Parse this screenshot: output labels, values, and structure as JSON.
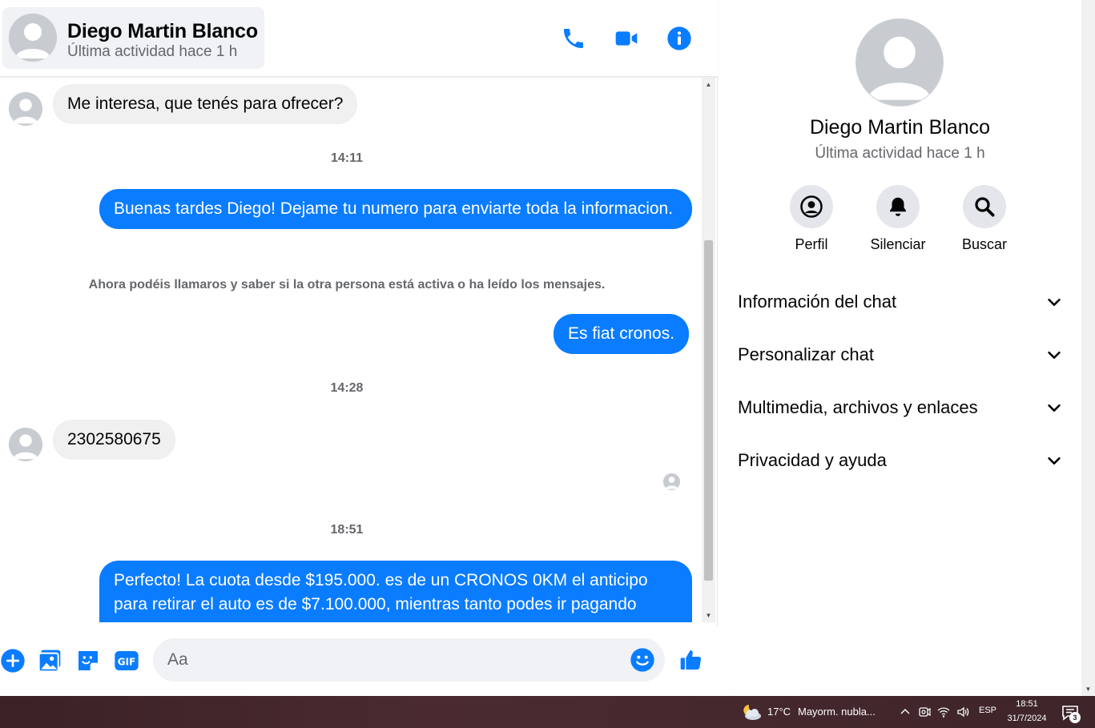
{
  "contact": {
    "name": "Diego Martin Blanco",
    "status": "Última actividad hace 1 h"
  },
  "messages": {
    "m1": "Me interesa, que tenés para ofrecer?",
    "t1": "14:11",
    "m2": "Buenas tardes Diego! Dejame tu numero para enviarte toda la informacion.",
    "note": "Ahora podéis llamaros y saber si la otra persona está activa o ha leído los mensajes.",
    "m3": "Es fiat cronos.",
    "t2": "14:28",
    "m4": "2302580675",
    "t3": "18:51",
    "m5": "Perfecto! La cuota desde $195.000. es de un CRONOS 0KM el anticipo para retirar el auto es de $7.100.000, mientras tanto podes ir pagando"
  },
  "composer": {
    "placeholder": "Aa"
  },
  "info_panel": {
    "actions": [
      "Perfil",
      "Silenciar",
      "Buscar"
    ],
    "sections": [
      "Información del chat",
      "Personalizar chat",
      "Multimedia, archivos y enlaces",
      "Privacidad y ayuda"
    ]
  },
  "taskbar": {
    "temp": "17°C",
    "weather": "Mayorm. nubla...",
    "lang": "ESP",
    "time": "18:51",
    "date": "31/7/2024",
    "notifications": "3"
  },
  "colors": {
    "accent": "#0a7cff",
    "incoming_bubble": "#f0f0f0"
  }
}
